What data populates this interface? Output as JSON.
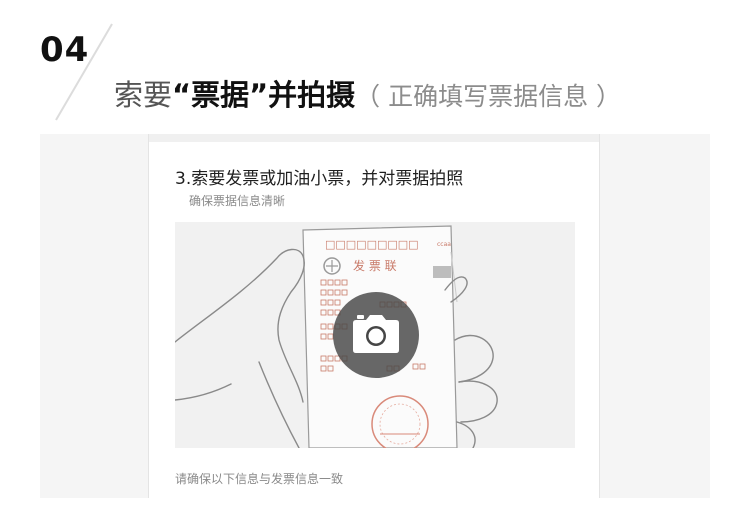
{
  "header": {
    "step_number": "04",
    "title_prefix": "索要",
    "title_quoted": "“票据”",
    "title_middle": "并拍摄",
    "title_sub": "（ 正确填写票据信息 ）"
  },
  "card": {
    "title": "3.索要发票或加油小票，并对票据拍照",
    "subtitle": "确保票据信息清晰",
    "footer": "请确保以下信息与发票信息一致"
  },
  "receipt": {
    "header_text": "发 票 联",
    "code_boxes": "□□□□□□□□□",
    "code_suffix": "ccaa"
  },
  "icons": {
    "camera": "camera-icon",
    "hand": "hand-illustration",
    "receipt": "receipt-illustration",
    "stamp": "stamp-illustration"
  },
  "colors": {
    "stamp": "#d98a7a",
    "receipt_text": "#c97b6a",
    "overlay": "#464646"
  }
}
